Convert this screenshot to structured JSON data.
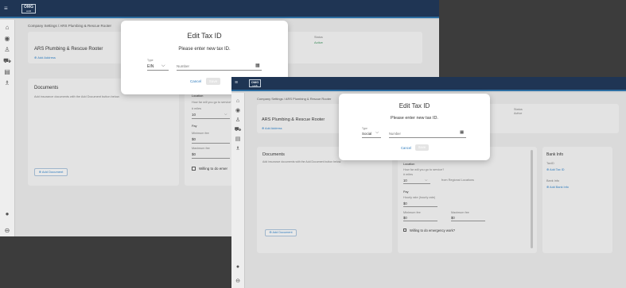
{
  "app": {
    "logo": "OMG",
    "logo_sub": "HUB",
    "menu_glyph": "≡"
  },
  "breadcrumb": "Company Settings  /  ARS Plumbing & Rescue Rooter",
  "vendor": {
    "name": "ARS Plumbing & Rescue Rooter",
    "add_address": "Add Address",
    "status_label": "Status",
    "status_value": "Active"
  },
  "documents": {
    "title": "Documents",
    "empty_text": "Add insurance documents with the Add Document button below.",
    "add_button": "Add Document"
  },
  "service": {
    "location_label": "Location",
    "location_hint": "How far will you go to service?",
    "radius_label": "# miles",
    "radius_value": "10",
    "from_text": "from Regional Locations",
    "pay_label": "Pay",
    "hourly_label": "Hourly rate (hourly rate)",
    "hourly_value": "$0",
    "min_fee_label": "Minimum fee",
    "min_fee_value": "$0",
    "max_fee_label": "Maximum fee",
    "max_fee_value": "$0",
    "emergency_label": "Willing to do emergency work?",
    "emergency_label_truncated": "Willing to do emer"
  },
  "bank": {
    "title": "Bank Info",
    "taxid_label": "TaxID",
    "add_taxid": "Add Tax ID",
    "bankinfo_label": "Bank Info",
    "add_bankinfo": "Add Bank Info"
  },
  "dialog_a": {
    "title": "Edit Tax ID",
    "message": "Please enter new tax ID.",
    "type_label": "Type",
    "type_value": "EIN",
    "number_placeholder": "Number",
    "cancel": "Cancel",
    "save": "Save"
  },
  "dialog_b": {
    "title": "Edit Tax ID",
    "message": "Please enter new tax ID.",
    "type_label": "Type",
    "type_value": "Social",
    "number_placeholder": "Number",
    "cancel": "Cancel",
    "save": "Save"
  },
  "icons": {
    "home": "home-icon",
    "eye": "eye-icon",
    "people": "people-icon",
    "truck": "truck-icon",
    "doc": "document-icon",
    "person": "person-icon",
    "account": "account-icon",
    "logout": "logout-icon"
  },
  "colors": {
    "topbar": "#1f3554",
    "accent": "#2e7bbd",
    "active_status": "#3c8c5a",
    "backdrop": "#d4d4d4"
  }
}
